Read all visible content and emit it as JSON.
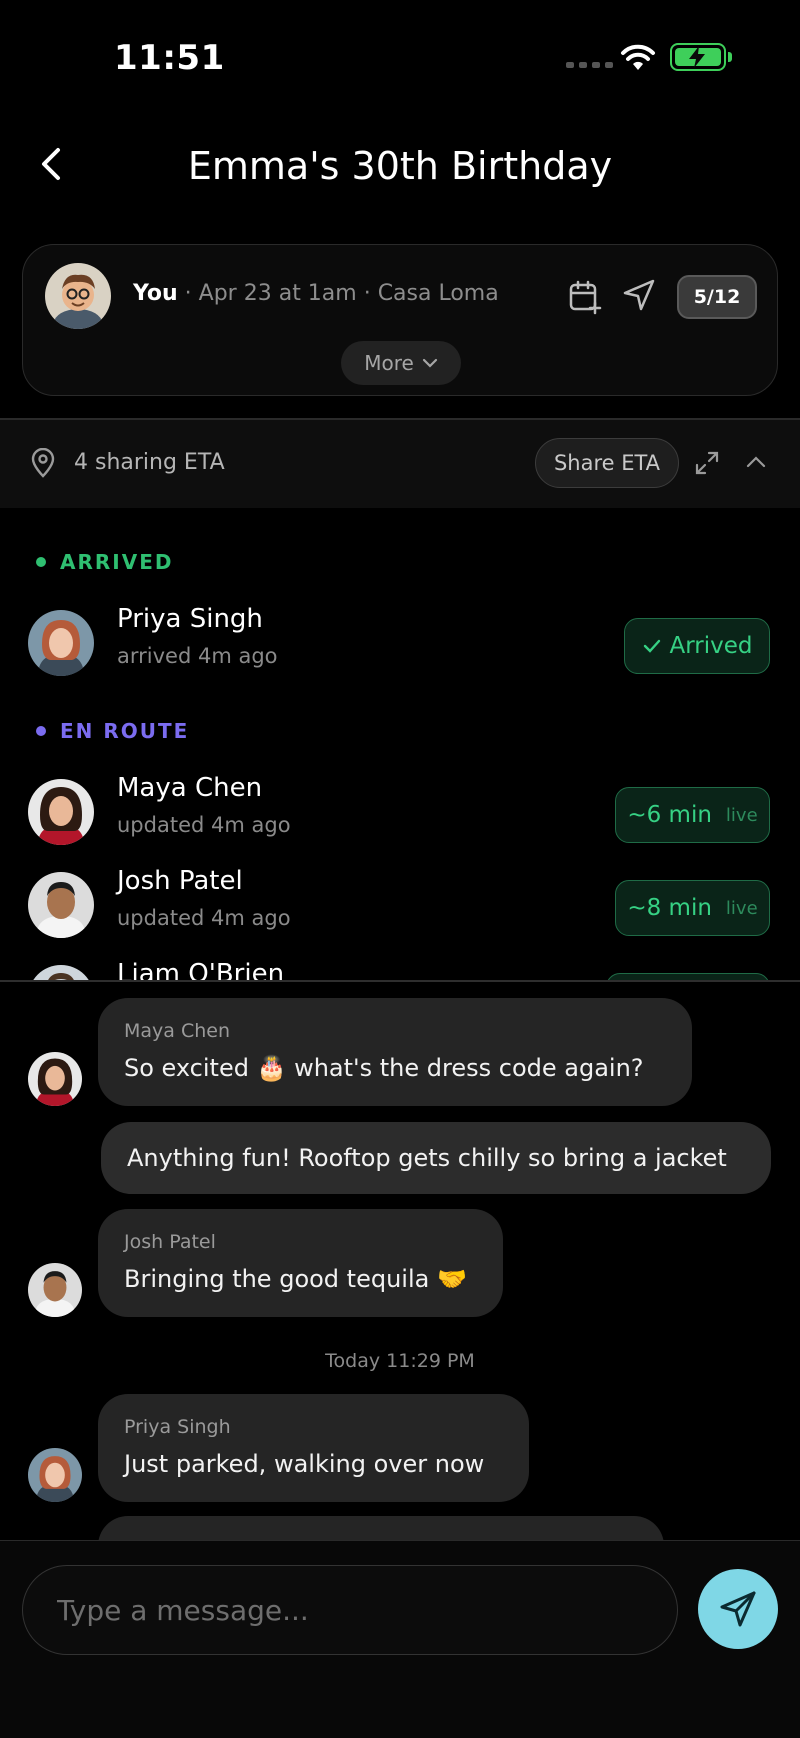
{
  "status_bar": {
    "time": "11:51"
  },
  "header": {
    "title": "Emma's 30th Birthday",
    "back_icon": "chevron-left-icon"
  },
  "event": {
    "host": "You",
    "details": " · Apr 23 at 1am · Casa Loma",
    "attendee_count": "5/12",
    "more_label": "More"
  },
  "eta": {
    "sharing_text": "4 sharing ETA",
    "share_label": "Share ETA"
  },
  "sections": {
    "arrived": "ARRIVED",
    "en_route": "EN ROUTE"
  },
  "arrived": [
    {
      "name": "Priya Singh",
      "sub": "arrived 4m ago",
      "status": "Arrived"
    }
  ],
  "en_route": [
    {
      "name": "Maya Chen",
      "sub": "updated 4m ago",
      "eta": "~6 min",
      "live": "live"
    },
    {
      "name": "Josh Patel",
      "sub": "updated 4m ago",
      "eta": "~8 min",
      "live": "live"
    },
    {
      "name": "Liam O'Brien"
    }
  ],
  "messages": [
    {
      "sender": "Maya Chen",
      "text": "So excited 🎂  what's the dress code again?"
    },
    {
      "own": true,
      "text": "Anything fun! Rooftop gets chilly so bring a jacket"
    },
    {
      "sender": "Josh Patel",
      "text": "Bringing the good tequila 🤝"
    },
    {
      "sender": "Priya Singh",
      "text": "Just parked, walking over now"
    }
  ],
  "day_separator": "Today 11:29 PM",
  "composer": {
    "placeholder": "Type a message..."
  },
  "colors": {
    "accent": "#7fd7e6",
    "arrived": "#2fbf71",
    "en_route": "#7b6cf0"
  }
}
